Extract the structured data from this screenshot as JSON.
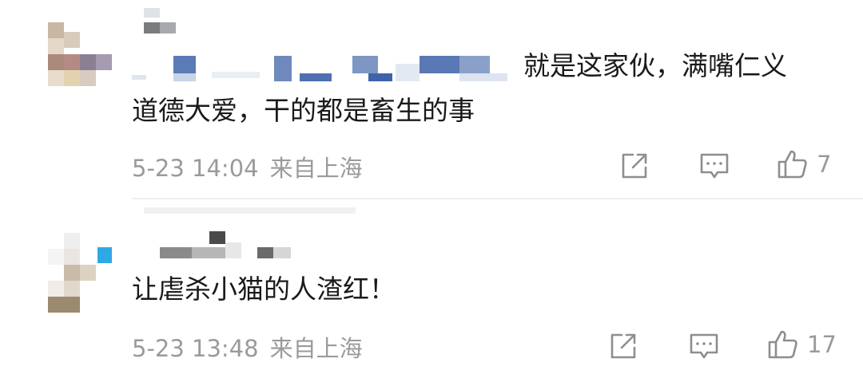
{
  "comments": [
    {
      "text_line1": "就是这家伙，满嘴仁义",
      "text_line2": "道德大爱，干的都是畜生的事",
      "time": "5-23 14:04",
      "location": "来自上海",
      "likes": "7",
      "icons": {
        "share": "share-icon",
        "reply": "comment-icon",
        "like": "thumbs-up-icon"
      }
    },
    {
      "text_line1": "让虐杀小猫的人渣红！",
      "time": "5-23 13:48",
      "location": "来自上海",
      "likes": "17",
      "icons": {
        "share": "share-icon",
        "reply": "comment-icon",
        "like": "thumbs-up-icon"
      }
    }
  ],
  "colors": {
    "meta_gray": "#9a9a9a",
    "text": "#1a1a1a",
    "divider": "#efefef"
  }
}
